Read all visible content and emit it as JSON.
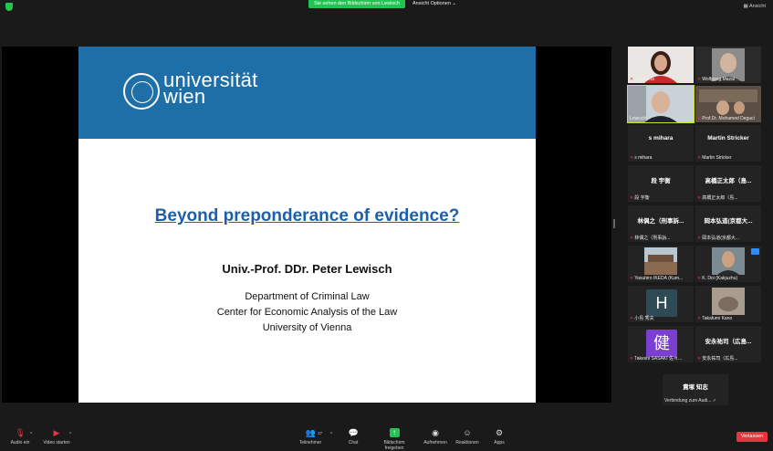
{
  "topbar": {
    "viewing_text": "Sie sehen den Bildschirm von Lewisch",
    "view_options": "Ansicht Optionen",
    "view_button": "Ansicht"
  },
  "slide": {
    "logo_line1": "universität",
    "logo_line2": "wien",
    "title": "Beyond preponderance of evidence?",
    "author": "Univ.-Prof. DDr. Peter Lewisch",
    "affiliation": [
      "Department of Criminal Law",
      "Center for Economic Analysis of the Law",
      "University of Vienna"
    ]
  },
  "participants": [
    {
      "name": "Tateyama",
      "type": "video-woman"
    },
    {
      "name": "Wolfgang Mazal",
      "type": "video-man"
    },
    {
      "name": "Lewisch",
      "type": "video-lewisch",
      "active": true
    },
    {
      "name": "Prof.Dr. Mohamed Deguci",
      "type": "video-room"
    },
    {
      "name": "s mihara",
      "center": "s mihara"
    },
    {
      "name": "Martin Stricker",
      "center": "Martin Stricker"
    },
    {
      "name": "段 宇衡",
      "center": "段 宇衡"
    },
    {
      "name": "高橋正太郎（島...",
      "center": "高橋正太郎（島..."
    },
    {
      "name": "林偶之（刑事訴...",
      "center": "林偶之（刑事訴..."
    },
    {
      "name": "岡本弘道(京都大...",
      "center": "岡本弘道(京都大..."
    },
    {
      "name": "Yasuhiro IKEDA (Kum...",
      "type": "video-building"
    },
    {
      "name": "K. Doi (Kakjuzhu)",
      "type": "video-doi"
    },
    {
      "name": "小島 秀夫",
      "avatar": "H",
      "avatar_color": "#2f4a55"
    },
    {
      "name": "Takafumi Kano",
      "type": "video-cat"
    },
    {
      "name": "Takeshi SASAKI 佐々...",
      "avatar": "健",
      "avatar_color": "#7a3fd1"
    },
    {
      "name": "安永祐司（広島...",
      "center": "安永祐司（広島..."
    }
  ],
  "connecting": {
    "center": "責塚 知志",
    "status": "Verbindung zum Audi..."
  },
  "bottombar": {
    "audio": "Audio ein",
    "video": "Video starten",
    "participants": "Teilnehmer",
    "participants_count": "17",
    "chat": "Chat",
    "share": "Bildschirm freigeben",
    "record": "Aufnehmen",
    "reactions": "Reaktionen",
    "apps": "Apps",
    "leave": "Verlassen"
  },
  "colors": {
    "accent_green": "#23c552",
    "leave_red": "#e0383e",
    "slide_header": "#1e6ea8",
    "title_blue": "#1f5fa8",
    "active_speaker": "#d7df23"
  }
}
